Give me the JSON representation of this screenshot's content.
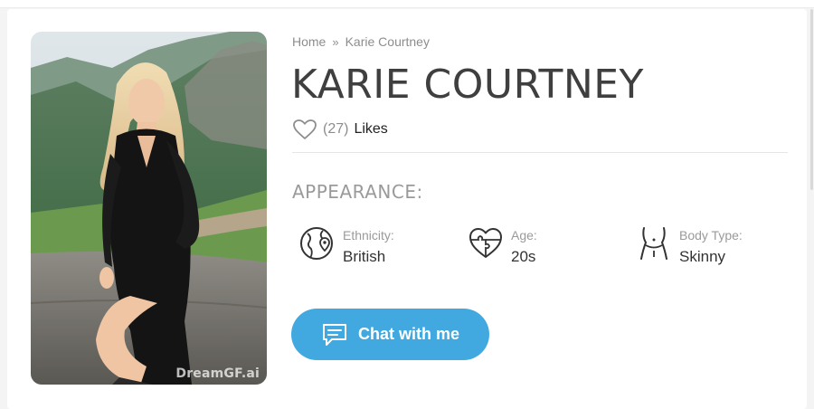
{
  "breadcrumb": {
    "home": "Home",
    "separator": "»",
    "current": "Karie Courtney"
  },
  "profile": {
    "name": "KARIE COURTNEY",
    "likes_count": "(27)",
    "likes_label": "Likes",
    "photo_watermark": "DreamGF.ai"
  },
  "appearance": {
    "title": "APPEARANCE:",
    "items": [
      {
        "label": "Ethnicity:",
        "value": "British",
        "icon": "globe-pin-icon"
      },
      {
        "label": "Age:",
        "value": "20s",
        "icon": "heart-puzzle-icon"
      },
      {
        "label": "Body Type:",
        "value": "Skinny",
        "icon": "body-figure-icon"
      }
    ]
  },
  "cta": {
    "label": "Chat with me",
    "icon": "chat-bubble-icon"
  },
  "colors": {
    "accent": "#42a9e0",
    "title": "#3f3f3f",
    "muted": "#9a9a9a"
  }
}
